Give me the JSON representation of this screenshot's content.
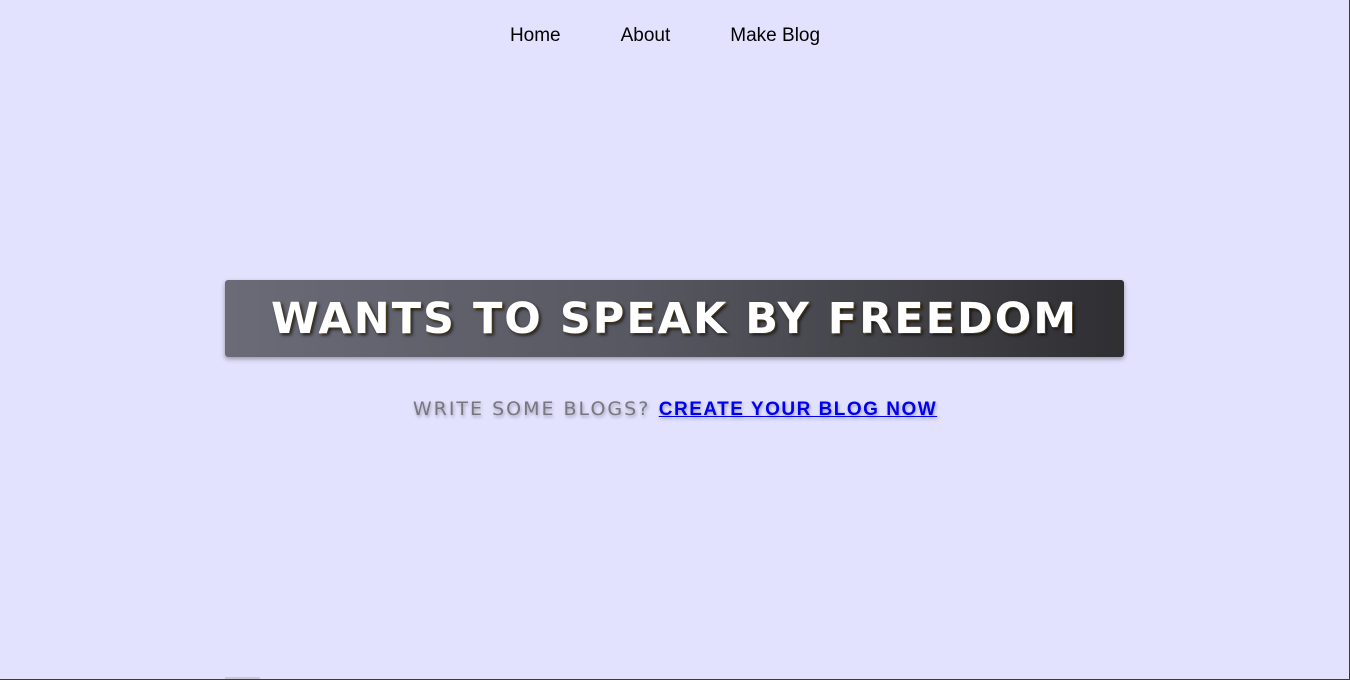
{
  "nav": {
    "items": [
      {
        "label": "Home"
      },
      {
        "label": "About"
      },
      {
        "label": "Make Blog"
      }
    ]
  },
  "hero": {
    "title": "WANTS TO SPEAK BY FREEDOM"
  },
  "tagline": {
    "text": "WRITE SOME BLOGS?",
    "link_label": "CREATE YOUR BLOG NOW"
  },
  "colors": {
    "background": "#e2e2fe",
    "banner_start": "#6b6b78",
    "banner_end": "#2f2f32",
    "link": "#0000ee",
    "tagline_text": "#77777f"
  }
}
